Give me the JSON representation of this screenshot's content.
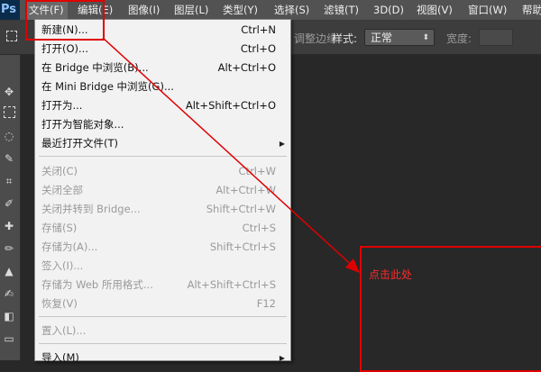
{
  "app": {
    "logo": "Ps"
  },
  "menubar": {
    "items": [
      "文件(F)",
      "编辑(E)",
      "图像(I)",
      "图层(L)",
      "类型(Y)",
      "选择(S)",
      "滤镜(T)",
      "3D(D)",
      "视图(V)",
      "窗口(W)",
      "帮助"
    ]
  },
  "options_bar": {
    "partial_text": "调整边缘",
    "style_label": "样式:",
    "style_value": "正常",
    "width_label": "宽度:"
  },
  "file_menu": {
    "items": [
      {
        "label": "新建(N)...",
        "shortcut": "Ctrl+N"
      },
      {
        "label": "打开(O)...",
        "shortcut": "Ctrl+O"
      },
      {
        "label": "在 Bridge 中浏览(B)...",
        "shortcut": "Alt+Ctrl+O"
      },
      {
        "label": "在 Mini Bridge 中浏览(G)...",
        "shortcut": ""
      },
      {
        "label": "打开为...",
        "shortcut": "Alt+Shift+Ctrl+O"
      },
      {
        "label": "打开为智能对象...",
        "shortcut": ""
      },
      {
        "label": "最近打开文件(T)",
        "shortcut": ""
      },
      {
        "label": "关闭(C)",
        "shortcut": "Ctrl+W"
      },
      {
        "label": "关闭全部",
        "shortcut": "Alt+Ctrl+W"
      },
      {
        "label": "关闭并转到 Bridge...",
        "shortcut": "Shift+Ctrl+W"
      },
      {
        "label": "存储(S)",
        "shortcut": "Ctrl+S"
      },
      {
        "label": "存储为(A)...",
        "shortcut": "Shift+Ctrl+S"
      },
      {
        "label": "签入(I)...",
        "shortcut": ""
      },
      {
        "label": "存储为 Web 所用格式...",
        "shortcut": "Alt+Shift+Ctrl+S"
      },
      {
        "label": "恢复(V)",
        "shortcut": "F12"
      },
      {
        "label": "置入(L)...",
        "shortcut": ""
      },
      {
        "label": "导入(M)",
        "shortcut": ""
      }
    ]
  },
  "annotation": {
    "text": "点击此处",
    "color": "#e00000"
  }
}
